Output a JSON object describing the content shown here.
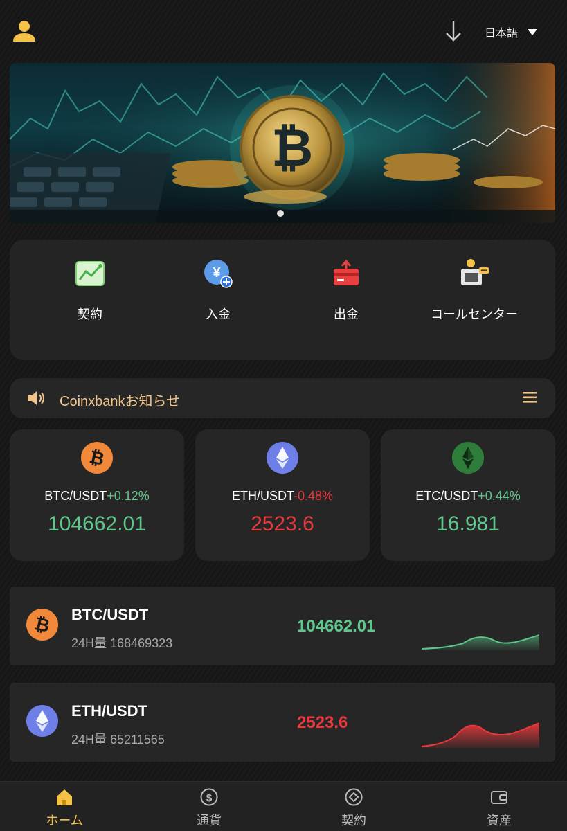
{
  "header": {
    "language": "日本語",
    "avatar_icon": "user-icon",
    "download_icon": "download-arrow-icon"
  },
  "banner": {
    "image_icon": "bitcoin-banner-image",
    "carousel_indicator": "carousel-dot"
  },
  "quick_actions": [
    {
      "label": "契約",
      "icon": "chart-contract-icon"
    },
    {
      "label": "入金",
      "icon": "yen-deposit-icon"
    },
    {
      "label": "出金",
      "icon": "card-withdraw-icon"
    },
    {
      "label": "コールセンター",
      "icon": "support-agent-icon"
    }
  ],
  "notice": {
    "text": "Coinxbankお知らせ",
    "speaker_icon": "speaker-icon",
    "menu_icon": "menu-icon"
  },
  "ticker_cards": [
    {
      "pair": "BTC/USDT",
      "change": "+0.12%",
      "price": "104662.01",
      "trend": "up",
      "icon": "btc-icon"
    },
    {
      "pair": "ETH/USDT",
      "change": "-0.48%",
      "price": "2523.6",
      "trend": "down",
      "icon": "eth-icon"
    },
    {
      "pair": "ETC/USDT",
      "change": "+0.44%",
      "price": "16.981",
      "trend": "up",
      "icon": "etc-icon"
    }
  ],
  "market_list": [
    {
      "pair": "BTC/USDT",
      "volume_label": "24H量",
      "volume": "168469323",
      "price": "104662.01",
      "trend": "up",
      "icon": "btc-icon"
    },
    {
      "pair": "ETH/USDT",
      "volume_label": "24H量",
      "volume": "65211565",
      "price": "2523.6",
      "trend": "down",
      "icon": "eth-icon"
    }
  ],
  "tabbar": [
    {
      "label": "ホーム",
      "icon": "home-icon",
      "active": true
    },
    {
      "label": "通貨",
      "icon": "dollar-coin-icon",
      "active": false
    },
    {
      "label": "契約",
      "icon": "contract-diamond-icon",
      "active": false
    },
    {
      "label": "資産",
      "icon": "wallet-icon",
      "active": false
    }
  ],
  "colors": {
    "up": "#5ec78b",
    "down": "#e8393c",
    "accent": "#f6c147",
    "notice_text": "#f3c48a",
    "card_bg": "#262626",
    "page_bg": "#151515"
  }
}
